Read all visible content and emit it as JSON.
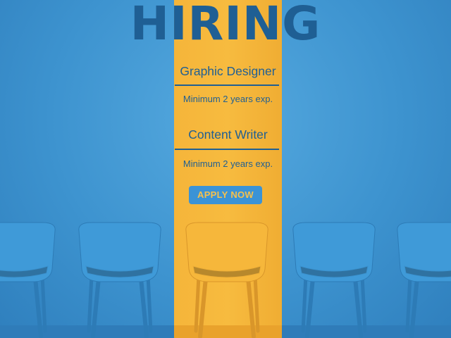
{
  "headline": "HIRING",
  "jobs": [
    {
      "title": "Graphic Designer",
      "requirement": "Minimum 2 years exp."
    },
    {
      "title": "Content Writer",
      "requirement": "Minimum 2 years exp."
    }
  ],
  "cta": {
    "label": "APPLY NOW"
  },
  "colors": {
    "background": "#3d93cf",
    "accent_stripe": "#f7bb3f",
    "text": "#1f5f94",
    "button": "#3b93d6",
    "button_text": "#f6c14c",
    "chair_blue": "#3f9ad8",
    "chair_yellow": "#f6b73b"
  },
  "chairs": [
    "blue",
    "blue",
    "yellow",
    "blue",
    "blue"
  ]
}
